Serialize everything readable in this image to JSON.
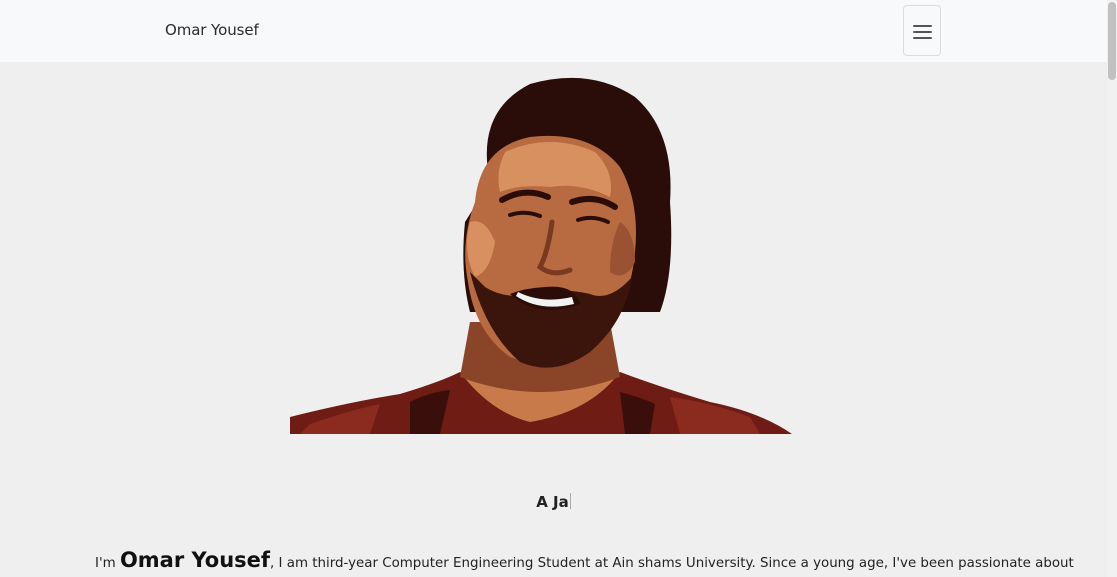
{
  "navbar": {
    "brand": "Omar Yousef",
    "menu_icon": "hamburger-menu-icon"
  },
  "hero": {
    "portrait_alt": "Omar Yousef portrait",
    "colors": {
      "hair": "#2a0d08",
      "skin": "#b86a40",
      "skin_light": "#d89060",
      "shirt": "#6e1c14"
    }
  },
  "typed_text": "A Ja",
  "intro": {
    "prefix": "I'm ",
    "name": "Omar Yousef",
    "suffix": ", I am third-year Computer Engineering Student at Ain shams University. Since a young age, I've been passionate about"
  }
}
